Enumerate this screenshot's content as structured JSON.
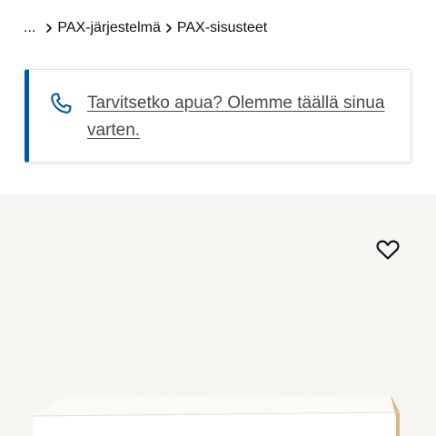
{
  "breadcrumb": {
    "ellipsis": "...",
    "items": [
      {
        "label": "PAX-järjestelmä"
      },
      {
        "label": "PAX-sisusteet"
      }
    ]
  },
  "help_card": {
    "text": "Tarvitsetko apua? Olemme täällä sinua varten.",
    "icon": "phone-icon",
    "accent_color": "#0058a3"
  },
  "product": {
    "favorite_icon": "heart-outline-icon",
    "image_description_icon": "white-shelf-image"
  },
  "colors": {
    "background": "#ffffff",
    "image_background": "#f6f5f1",
    "text": "#111111",
    "link_text": "#484848",
    "accent": "#0058a3"
  }
}
